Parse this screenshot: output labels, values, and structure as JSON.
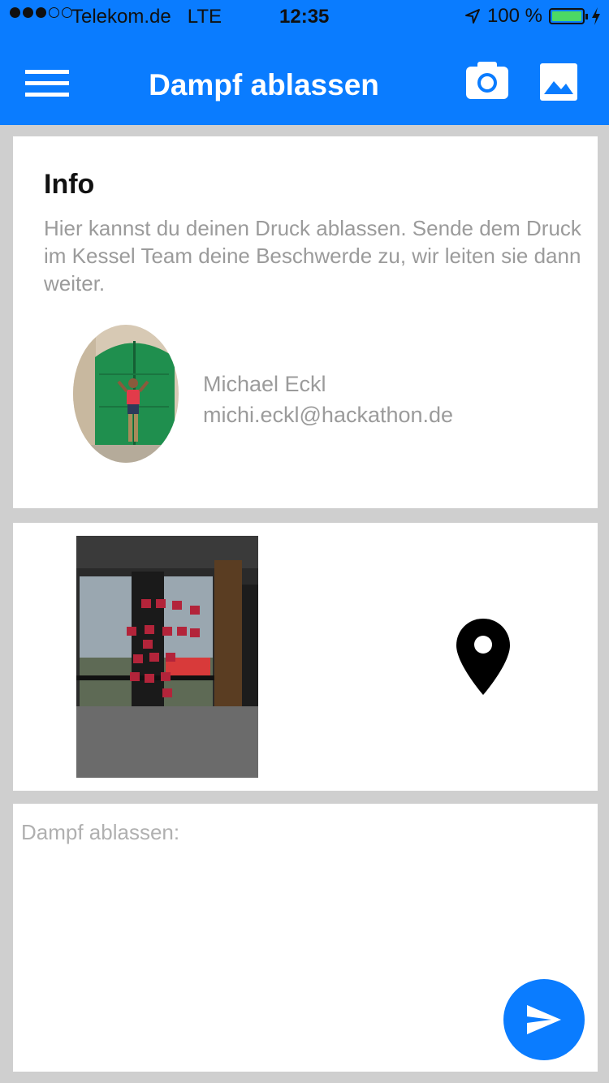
{
  "status": {
    "carrier": "Telekom.de",
    "network": "LTE",
    "time": "12:35",
    "battery": "100 %",
    "battery_level": 1.0,
    "signal_bars": 3,
    "signal_total": 5
  },
  "navbar": {
    "title": "Dampf ablassen",
    "menu_icon": "hamburger-menu-icon",
    "camera_icon": "camera-icon",
    "gallery_icon": "image-gallery-icon"
  },
  "info": {
    "heading": "Info",
    "text": "Hier kannst du deinen Druck ablassen. Sende dem Druck im Kessel Team deine Beschwerde zu, wir leiten sie dann weiter.",
    "contact_name": "Michael Eckl",
    "contact_email": "michi.eckl@hackathon.de"
  },
  "attachment": {
    "location_icon": "map-pin-icon"
  },
  "message": {
    "placeholder": "Dampf ablassen:",
    "value": "",
    "send_icon": "send-icon"
  },
  "colors": {
    "primary": "#0a7cff",
    "background": "#cfcfcf",
    "muted_text": "#9b9b9b",
    "battery": "#4cd964"
  }
}
